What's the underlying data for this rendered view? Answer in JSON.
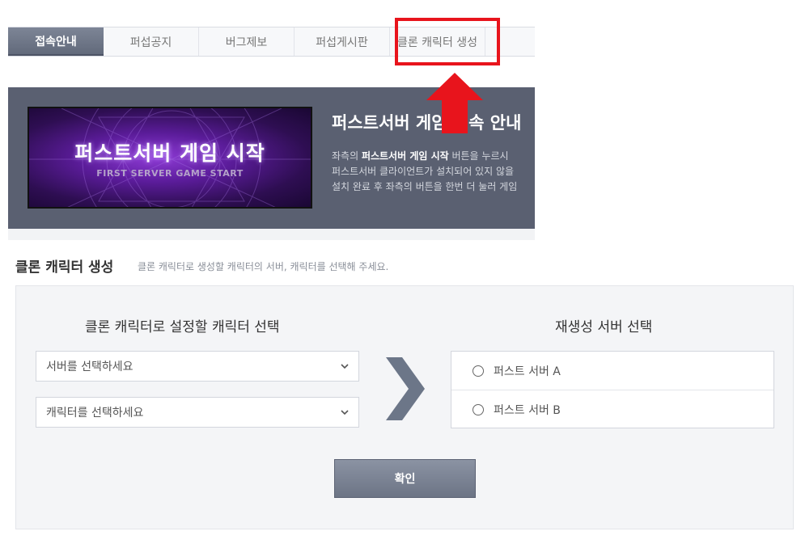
{
  "tabs": [
    {
      "label": "접속안내",
      "active": true
    },
    {
      "label": "퍼섭공지",
      "active": false
    },
    {
      "label": "버그제보",
      "active": false
    },
    {
      "label": "퍼섭게시판",
      "active": false
    },
    {
      "label": "클론 캐릭터 생성",
      "active": false
    }
  ],
  "banner": {
    "game_start_title": "퍼스트서버 게임 시작",
    "game_start_subtitle": "FIRST SERVER GAME START",
    "title": "퍼스트서버 게임 접속 안내",
    "desc_line1_prefix": "좌측의 ",
    "desc_line1_bold": "퍼스트서버 게임 시작",
    "desc_line1_suffix": " 버튼을 누르시",
    "desc_line2": "퍼스트서버 클라이언트가 설치되어 있지 않을",
    "desc_line3": "설치 완료 후 좌측의 버튼을 한번 더 눌러 게임"
  },
  "section": {
    "title": "클론 캐릭터 생성",
    "subtitle": "클론 캐릭터로 생성할 캐릭터의 서버, 캐릭터를 선택해 주세요."
  },
  "form": {
    "left_heading": "클론 캐릭터로 설정할 캐릭터 선택",
    "right_heading": "재생성 서버 선택",
    "server_select_value": "서버를 선택하세요",
    "character_select_value": "캐릭터를 선택하세요",
    "servers": [
      "퍼스트 서버 A",
      "퍼스트 서버 B"
    ],
    "confirm_label": "확인"
  },
  "colors": {
    "highlight": "#e8141c",
    "tab_active": "#6b7384",
    "banner_bg": "#5a6071",
    "chevron": "#6c7688"
  },
  "icons": {
    "select_arrow": "chevron-down-icon",
    "transfer_arrow": "chevron-right-icon",
    "annotation_arrow": "red-up-arrow-icon"
  }
}
